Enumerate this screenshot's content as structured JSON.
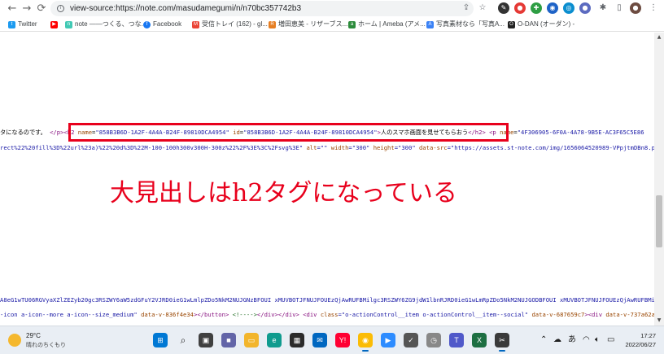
{
  "browser": {
    "url": "view-source:https://note.com/masudamegumi/n/n70bc357742b3",
    "bookmarks": [
      {
        "label": "Twitter",
        "icon": "twitter-icon",
        "color": "#1d9bf0"
      },
      {
        "label": "",
        "icon": "youtube-icon",
        "color": "#ff0000"
      },
      {
        "label": "note ――つくる、つな...",
        "icon": "note-icon",
        "color": "#41c9b4"
      },
      {
        "label": "Facebook",
        "icon": "facebook-icon",
        "color": "#1877f2"
      },
      {
        "label": "受信トレイ (162) - gl...",
        "icon": "gmail-icon",
        "color": "#ea4335"
      },
      {
        "label": "増田恵美 - リザーブス...",
        "icon": "reserve-icon",
        "color": "#e67e22"
      },
      {
        "label": "ホーム | Ameba (アメ...",
        "icon": "ameba-icon",
        "color": "#2d8c3c"
      },
      {
        "label": "写真素材なら「写真A...",
        "icon": "photoac-icon",
        "color": "#3b82f6"
      },
      {
        "label": "O-DAN (オーダン) -",
        "icon": "odan-icon",
        "color": "#222222"
      }
    ]
  },
  "source": {
    "line1": {
      "prefix": "タになるのです。",
      "close_p": "</p>",
      "h2_open": "<h2",
      "name_attr": "name",
      "name_val": "\"858B3B6D-1A2F-4A4A-B24F-89810DCA4954\"",
      "id_attr": "id",
      "id_val": "\"858B3B6D-1A2F-4A4A-B24F-89810DCA4954\"",
      "gt": ">",
      "heading_text": "人のスマホ画面を見せてもらおう",
      "h2_close": "</h2>",
      "next_tag": "<p",
      "next_attr": "name",
      "next_val": "\"4F306905-6F0A-4A78-9B5E-AC3F65C5E86"
    },
    "line2": {
      "part1": "rect%22%20fill%3D%22url%23a)%22%20d%3D%22M-100-100h300v300H-300z%22%2F%3E%3C%2Fsvg%3E\"",
      "alt_attr": "alt",
      "eq1": "=\"\"",
      "width_attr": "width",
      "width_val": "=\"300\"",
      "height_attr": "height",
      "height_val": "=\"300\"",
      "datasrc_attr": "data-src",
      "datasrc_val": "=\"https://assets.st-note.com/img/1656064520989-VPpjtmDBn8.png\""
    },
    "line3": "A8eG1wTU06RGVyaXZlZEZyb20gc3RSZWY6aW5zdGFuY2VJRD0ieG1wLmlpZDo5NkM2NUJGNzBFOUI xMUVBOTJFNUJFOUEzQjAwRUFBMilgc3RSZWY6ZG9jdW1lbnRJRD0ieG1wLmRpZDo5NkM2NUJGODBFOUI xMUVBOTJFNUJFOUEzQjAwRUFBMilvPiA8",
    "line4": {
      "part1": "-icon a-icon--more a-icon--size_medium\"",
      "dv1_attr": "data-v-836f4e34",
      "part2": "></button>",
      "comment": "<!---->",
      "part3": "</div></div>",
      "div_open": "<div",
      "class_attr": "class",
      "class_val": "=\"o-actionControl__item o-actionControl__item--social\"",
      "dv2_attr": "data-v-687659c7",
      "part4": "><div",
      "dv3_attr": "data-v-737a62a6",
      "tail": "da"
    }
  },
  "annotation": {
    "caption": "大見出しはh2タグになっている",
    "color": "#e8001c"
  },
  "taskbar": {
    "temperature": "29°C",
    "weather": "晴れのちくもり",
    "ime": "あ",
    "time": "17:27",
    "date": "2022/06/27"
  }
}
